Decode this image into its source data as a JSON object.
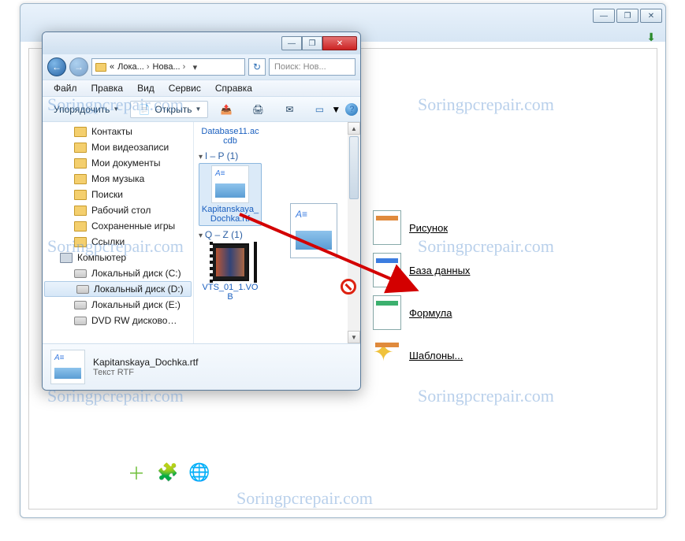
{
  "watermark": "Soringpcrepair.com",
  "back_window": {
    "controls": {
      "min": "—",
      "max": "❐",
      "close": "✕"
    },
    "dl_icon": "⬇",
    "items": [
      {
        "name": "item-picture",
        "label": "Рисунок",
        "icon": "doc-ico"
      },
      {
        "name": "item-database",
        "label": "База данных",
        "icon": "doc-ico blue"
      },
      {
        "name": "item-formula",
        "label": "Формула",
        "icon": "doc-ico green"
      },
      {
        "name": "item-templates",
        "label": "Шаблоны...",
        "icon": "doc-ico star",
        "star": "✦"
      }
    ],
    "footer": {
      "plus": "＋",
      "puzzle": "🧩",
      "globe": "🌐"
    }
  },
  "explorer": {
    "controls": {
      "min": "—",
      "max": "❐",
      "close": "✕"
    },
    "nav": {
      "back": "←",
      "fwd": "→"
    },
    "breadcrumb": {
      "prefix": "«",
      "seg1": "Лока...",
      "seg2": "Нова...",
      "dd": "▾"
    },
    "refresh": "↻",
    "search_placeholder": "Поиск: Нов...",
    "menubar": [
      "Файл",
      "Правка",
      "Вид",
      "Сервис",
      "Справка"
    ],
    "toolbar": {
      "organize": "Упорядочить",
      "open": "Открыть",
      "share_icon": "📤",
      "print_icon": "🖨",
      "burn_icon": "✉",
      "views_icon": "▭",
      "help_icon": "?"
    },
    "tree": [
      {
        "lvl": 1,
        "icon": "ic",
        "label": "Контакты"
      },
      {
        "lvl": 1,
        "icon": "ic",
        "label": "Мои видеозаписи"
      },
      {
        "lvl": 1,
        "icon": "ic",
        "label": "Мои документы"
      },
      {
        "lvl": 1,
        "icon": "ic",
        "label": "Моя музыка"
      },
      {
        "lvl": 1,
        "icon": "ic",
        "label": "Поиски"
      },
      {
        "lvl": 1,
        "icon": "ic",
        "label": "Рабочий стол"
      },
      {
        "lvl": 1,
        "icon": "ic",
        "label": "Сохраненные игры"
      },
      {
        "lvl": 1,
        "icon": "ic",
        "label": "Ссылки"
      },
      {
        "lvl": 0,
        "icon": "ic comp",
        "label": "Компьютер"
      },
      {
        "lvl": 1,
        "icon": "ic drive",
        "label": "Локальный диск (C:)"
      },
      {
        "lvl": 1,
        "icon": "ic drive",
        "label": "Локальный диск (D:)",
        "selected": true
      },
      {
        "lvl": 1,
        "icon": "ic drive",
        "label": "Локальный диск (E:)"
      },
      {
        "lvl": 1,
        "icon": "ic drive",
        "label": "DVD RW дисковод (F:)",
        "cut": true
      }
    ],
    "groups": [
      {
        "label": "",
        "files": [
          {
            "name": "file-database11",
            "thumb": "doc",
            "label": "Database11.accdb"
          }
        ],
        "partial": true
      },
      {
        "label": "I – P (1)",
        "files": [
          {
            "name": "file-kapitanskaya",
            "thumb": "doc",
            "label": "Kapitanskaya_Dochka.rtf",
            "selected": true
          }
        ]
      },
      {
        "label": "Q – Z (1)",
        "files": [
          {
            "name": "file-vts",
            "thumb": "video",
            "label": "VTS_01_1.VOB"
          }
        ]
      }
    ],
    "details": {
      "name": "Kapitanskaya_Dochka.rtf",
      "type": "Текст RTF"
    }
  }
}
